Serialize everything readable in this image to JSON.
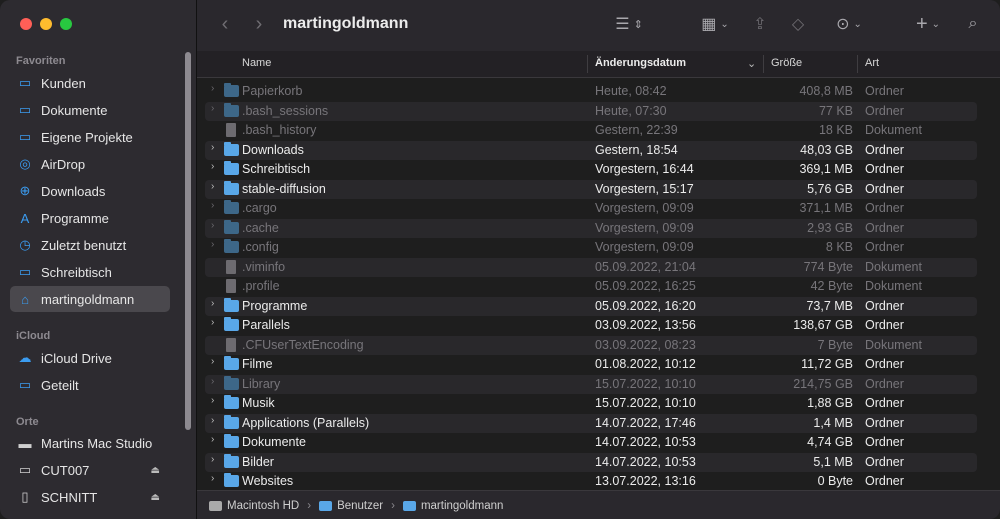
{
  "window": {
    "title": "martingoldmann"
  },
  "toolbar": {
    "back_icon": "chevron-left-icon",
    "forward_icon": "chevron-right-icon",
    "view_icon": "list-view-icon",
    "group_icon": "group-icon",
    "share_icon": "share-icon",
    "tag_icon": "tag-icon",
    "more_icon": "ellipsis-circle-icon",
    "add_icon": "plus-icon",
    "search_icon": "search-icon"
  },
  "sidebar": {
    "sections": [
      {
        "label": "Favoriten"
      },
      {
        "label": "iCloud"
      },
      {
        "label": "Orte"
      }
    ],
    "favorites": [
      {
        "label": "Kunden",
        "icon": "folder-icon"
      },
      {
        "label": "Dokumente",
        "icon": "document-folder-icon"
      },
      {
        "label": "Eigene Projekte",
        "icon": "folder-icon"
      },
      {
        "label": "AirDrop",
        "icon": "airdrop-icon"
      },
      {
        "label": "Downloads",
        "icon": "downloads-icon"
      },
      {
        "label": "Programme",
        "icon": "applications-icon"
      },
      {
        "label": "Zuletzt benutzt",
        "icon": "clock-icon"
      },
      {
        "label": "Schreibtisch",
        "icon": "desktop-icon"
      },
      {
        "label": "martingoldmann",
        "icon": "home-icon"
      }
    ],
    "icloud": [
      {
        "label": "iCloud Drive",
        "icon": "cloud-icon"
      },
      {
        "label": "Geteilt",
        "icon": "shared-folder-icon"
      }
    ],
    "locations": [
      {
        "label": "Martins Mac Studio",
        "icon": "computer-icon"
      },
      {
        "label": "CUT007",
        "icon": "drive-icon"
      },
      {
        "label": "SCHNITT",
        "icon": "document-drive-icon"
      }
    ]
  },
  "columns": {
    "name": "Name",
    "date": "Änderungsdatum",
    "size": "Größe",
    "kind": "Art"
  },
  "files": [
    {
      "name": "Papierkorb",
      "date": "Heute, 08:42",
      "size": "408,8 MB",
      "kind": "Ordner",
      "type": "folder",
      "dim": true
    },
    {
      "name": ".bash_sessions",
      "date": "Heute, 07:30",
      "size": "77 KB",
      "kind": "Ordner",
      "type": "folder",
      "dim": true
    },
    {
      "name": ".bash_history",
      "date": "Gestern, 22:39",
      "size": "18 KB",
      "kind": "Dokument",
      "type": "doc",
      "dim": true
    },
    {
      "name": "Downloads",
      "date": "Gestern, 18:54",
      "size": "48,03 GB",
      "kind": "Ordner",
      "type": "folder",
      "dim": false
    },
    {
      "name": "Schreibtisch",
      "date": "Vorgestern, 16:44",
      "size": "369,1 MB",
      "kind": "Ordner",
      "type": "folder",
      "dim": false
    },
    {
      "name": "stable-diffusion",
      "date": "Vorgestern, 15:17",
      "size": "5,76 GB",
      "kind": "Ordner",
      "type": "folder",
      "dim": false
    },
    {
      "name": ".cargo",
      "date": "Vorgestern, 09:09",
      "size": "371,1 MB",
      "kind": "Ordner",
      "type": "folder",
      "dim": true
    },
    {
      "name": ".cache",
      "date": "Vorgestern, 09:09",
      "size": "2,93 GB",
      "kind": "Ordner",
      "type": "folder",
      "dim": true
    },
    {
      "name": ".config",
      "date": "Vorgestern, 09:09",
      "size": "8 KB",
      "kind": "Ordner",
      "type": "folder",
      "dim": true
    },
    {
      "name": ".viminfo",
      "date": "05.09.2022, 21:04",
      "size": "774 Byte",
      "kind": "Dokument",
      "type": "doc",
      "dim": true
    },
    {
      "name": ".profile",
      "date": "05.09.2022, 16:25",
      "size": "42 Byte",
      "kind": "Dokument",
      "type": "doc",
      "dim": true
    },
    {
      "name": "Programme",
      "date": "05.09.2022, 16:20",
      "size": "73,7 MB",
      "kind": "Ordner",
      "type": "folder",
      "dim": false
    },
    {
      "name": "Parallels",
      "date": "03.09.2022, 13:56",
      "size": "138,67 GB",
      "kind": "Ordner",
      "type": "folder",
      "dim": false
    },
    {
      "name": ".CFUserTextEncoding",
      "date": "03.09.2022, 08:23",
      "size": "7 Byte",
      "kind": "Dokument",
      "type": "doc",
      "dim": true
    },
    {
      "name": "Filme",
      "date": "01.08.2022, 10:12",
      "size": "11,72 GB",
      "kind": "Ordner",
      "type": "folder",
      "dim": false
    },
    {
      "name": "Library",
      "date": "15.07.2022, 10:10",
      "size": "214,75 GB",
      "kind": "Ordner",
      "type": "folder",
      "dim": true
    },
    {
      "name": "Musik",
      "date": "15.07.2022, 10:10",
      "size": "1,88 GB",
      "kind": "Ordner",
      "type": "folder",
      "dim": false
    },
    {
      "name": "Applications (Parallels)",
      "date": "14.07.2022, 17:46",
      "size": "1,4 MB",
      "kind": "Ordner",
      "type": "folder",
      "dim": false
    },
    {
      "name": "Dokumente",
      "date": "14.07.2022, 10:53",
      "size": "4,74 GB",
      "kind": "Ordner",
      "type": "folder",
      "dim": false
    },
    {
      "name": "Bilder",
      "date": "14.07.2022, 10:53",
      "size": "5,1 MB",
      "kind": "Ordner",
      "type": "folder",
      "dim": false
    },
    {
      "name": "Websites",
      "date": "13.07.2022, 13:16",
      "size": "0 Byte",
      "kind": "Ordner",
      "type": "folder",
      "dim": false
    }
  ],
  "pathbar": [
    {
      "label": "Macintosh HD",
      "icon": "hard-disk-icon"
    },
    {
      "label": "Benutzer",
      "icon": "folder-icon"
    },
    {
      "label": "martingoldmann",
      "icon": "home-folder-icon"
    }
  ],
  "colors": {
    "accent": "#3b9cf0",
    "folder": "#59a7e8",
    "sidebar": "#2d2b30",
    "background": "#1e1e1e"
  }
}
